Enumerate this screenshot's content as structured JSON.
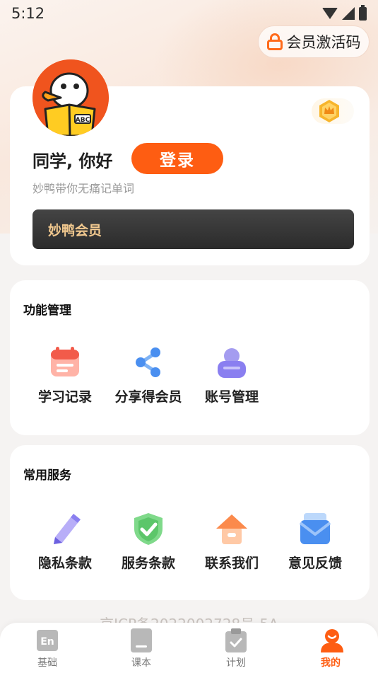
{
  "status_bar": {
    "time": "5:12"
  },
  "vip_code_button": {
    "label": "会员激活码"
  },
  "profile": {
    "greeting": "同学, 你好",
    "login_label": "登录",
    "subtitle": "妙鸭带你无痛记单词",
    "avatar_text": "ABC",
    "vip_bar_label": "妙鸭会员"
  },
  "function_section": {
    "title": "功能管理",
    "items": [
      {
        "label": "学习记录",
        "icon": "calendar-icon"
      },
      {
        "label": "分享得会员",
        "icon": "share-icon"
      },
      {
        "label": "账号管理",
        "icon": "account-icon"
      }
    ]
  },
  "service_section": {
    "title": "常用服务",
    "items": [
      {
        "label": "隐私条款",
        "icon": "pencil-icon"
      },
      {
        "label": "服务条款",
        "icon": "shield-check-icon"
      },
      {
        "label": "联系我们",
        "icon": "house-icon"
      },
      {
        "label": "意见反馈",
        "icon": "mail-icon"
      }
    ]
  },
  "footer": {
    "icp": "京ICP备2022002728号-5A"
  },
  "tab_bar": {
    "tabs": [
      {
        "label": "基础",
        "icon": "en-icon",
        "active": false
      },
      {
        "label": "课本",
        "icon": "book-icon",
        "active": false
      },
      {
        "label": "计划",
        "icon": "clipboard-check-icon",
        "active": false
      },
      {
        "label": "我的",
        "icon": "user-icon",
        "active": true
      }
    ]
  },
  "colors": {
    "accent": "#fe5d12",
    "vip_gold": "#f2c98f",
    "vip_bar": "#2b2b2b"
  }
}
